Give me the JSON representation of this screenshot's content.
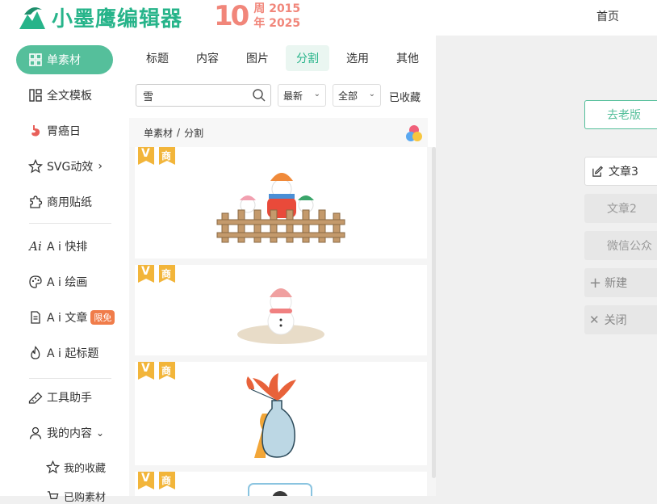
{
  "app": {
    "logo_text": "小墨鹰编辑器",
    "anniv_number": "10",
    "anniv_line1": "周 2015",
    "anniv_line2": "年 2025",
    "nav_home": "首页"
  },
  "sidebar": {
    "active": "单素材",
    "items": [
      "全文模板",
      "胃癌日",
      "SVG动效",
      "商用贴纸",
      "A i 快排",
      "A i 绘画",
      "A i 文章",
      "A i 起标题",
      "工具助手",
      "我的内容"
    ],
    "free_badge": "限免",
    "sub_items": [
      "我的收藏",
      "已购素材"
    ]
  },
  "panel": {
    "tabs": [
      "标题",
      "内容",
      "图片",
      "分割",
      "选用",
      "其他"
    ],
    "active_tab": "分割",
    "search_value": "雪",
    "sort_select": "最新",
    "range_select": "全部",
    "favorites": "已收藏",
    "breadcrumb": [
      "单素材",
      "分割"
    ],
    "tag_v": "V",
    "tag_shang": "商"
  },
  "right": {
    "old_version": "去老版",
    "docs": [
      "文章3",
      "文章2",
      "微信公众"
    ],
    "new_label": "新建",
    "close_label": "关闭"
  },
  "colors": {
    "brand": "#27b48a",
    "active_pill": "#55bf9b",
    "anniv": "#f1867a",
    "free_badge": "#f07c4a"
  }
}
